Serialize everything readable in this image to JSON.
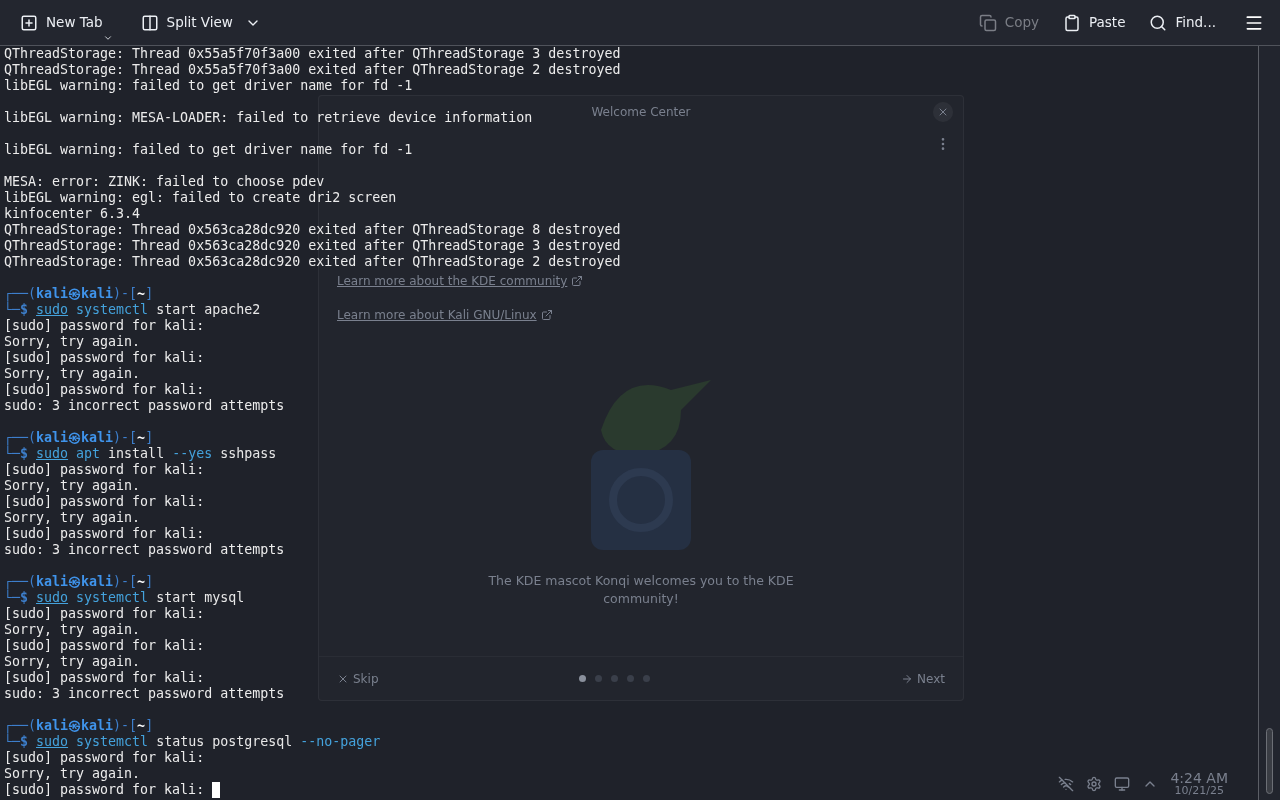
{
  "toolbar": {
    "left": [
      {
        "kind": "new_tab",
        "label": "New Tab"
      },
      {
        "kind": "split_view",
        "label": "Split View"
      }
    ],
    "right": [
      {
        "kind": "copy",
        "label": "Copy",
        "disabled": true
      },
      {
        "kind": "paste",
        "label": "Paste",
        "disabled": false
      },
      {
        "kind": "find",
        "label": "Find..."
      }
    ]
  },
  "background_window": {
    "title": "Welcome Center",
    "links": [
      "Learn more about the KDE community",
      "Learn more about Kali GNU/Linux"
    ],
    "caption": "The KDE mascot Konqi welcomes you to the KDE community!",
    "skip": "Skip",
    "next": "Next",
    "pages": [
      {
        "selected": true
      },
      {
        "selected": false
      },
      {
        "selected": false
      },
      {
        "selected": false
      },
      {
        "selected": false
      }
    ]
  },
  "desktop_clock": {
    "time": "4:24 AM",
    "date": "10/21/25"
  },
  "terminal": {
    "lines": [
      {
        "kind": "output",
        "text": "QThreadStorage: Thread 0x55a5f70f3a00 exited after QThreadStorage 3 destroyed"
      },
      {
        "kind": "output",
        "text": "QThreadStorage: Thread 0x55a5f70f3a00 exited after QThreadStorage 2 destroyed"
      },
      {
        "kind": "output",
        "text": "libEGL warning: failed to get driver name for fd -1"
      },
      {
        "kind": "blank"
      },
      {
        "kind": "output",
        "text": "libEGL warning: MESA-LOADER: failed to retrieve device information"
      },
      {
        "kind": "blank"
      },
      {
        "kind": "output",
        "text": "libEGL warning: failed to get driver name for fd -1"
      },
      {
        "kind": "blank"
      },
      {
        "kind": "output",
        "text": "MESA: error: ZINK: failed to choose pdev"
      },
      {
        "kind": "output",
        "text": "libEGL warning: egl: failed to create dri2 screen"
      },
      {
        "kind": "output",
        "text": "kinfocenter 6.3.4"
      },
      {
        "kind": "output",
        "text": "QThreadStorage: Thread 0x563ca28dc920 exited after QThreadStorage 8 destroyed"
      },
      {
        "kind": "output",
        "text": "QThreadStorage: Thread 0x563ca28dc920 exited after QThreadStorage 3 destroyed"
      },
      {
        "kind": "output",
        "text": "QThreadStorage: Thread 0x563ca28dc920 exited after QThreadStorage 2 destroyed"
      },
      {
        "kind": "blank"
      },
      {
        "kind": "prompt",
        "segments": [
          {
            "kind": "frame",
            "text": "┌──("
          },
          {
            "kind": "user",
            "text": "kali㉿kali"
          },
          {
            "kind": "frame",
            "text": ")-["
          },
          {
            "kind": "dir",
            "text": "~"
          },
          {
            "kind": "frame",
            "text": "]"
          }
        ]
      },
      {
        "kind": "command",
        "segments": [
          {
            "kind": "frame",
            "text": "└─$"
          },
          {
            "kind": "sudo",
            "text": "sudo"
          },
          {
            "kind": "program",
            "text": "systemctl"
          },
          {
            "kind": "arg",
            "text": "start"
          },
          {
            "kind": "arg",
            "text": "apache2"
          }
        ]
      },
      {
        "kind": "output",
        "text": "[sudo] password for kali:"
      },
      {
        "kind": "output",
        "text": "Sorry, try again."
      },
      {
        "kind": "output",
        "text": "[sudo] password for kali:"
      },
      {
        "kind": "output",
        "text": "Sorry, try again."
      },
      {
        "kind": "output",
        "text": "[sudo] password for kali:"
      },
      {
        "kind": "output",
        "text": "sudo: 3 incorrect password attempts"
      },
      {
        "kind": "blank"
      },
      {
        "kind": "prompt",
        "segments": [
          {
            "kind": "frame",
            "text": "┌──("
          },
          {
            "kind": "user",
            "text": "kali㉿kali"
          },
          {
            "kind": "frame",
            "text": ")-["
          },
          {
            "kind": "dir",
            "text": "~"
          },
          {
            "kind": "frame",
            "text": "]"
          }
        ]
      },
      {
        "kind": "command",
        "segments": [
          {
            "kind": "frame",
            "text": "└─$"
          },
          {
            "kind": "sudo",
            "text": "sudo"
          },
          {
            "kind": "program",
            "text": "apt"
          },
          {
            "kind": "arg",
            "text": "install"
          },
          {
            "kind": "option",
            "text": "--yes"
          },
          {
            "kind": "arg",
            "text": "sshpass"
          }
        ]
      },
      {
        "kind": "output",
        "text": "[sudo] password for kali:"
      },
      {
        "kind": "output",
        "text": "Sorry, try again."
      },
      {
        "kind": "output",
        "text": "[sudo] password for kali:"
      },
      {
        "kind": "output",
        "text": "Sorry, try again."
      },
      {
        "kind": "output",
        "text": "[sudo] password for kali:"
      },
      {
        "kind": "output",
        "text": "sudo: 3 incorrect password attempts"
      },
      {
        "kind": "blank"
      },
      {
        "kind": "prompt",
        "segments": [
          {
            "kind": "frame",
            "text": "┌──("
          },
          {
            "kind": "user",
            "text": "kali㉿kali"
          },
          {
            "kind": "frame",
            "text": ")-["
          },
          {
            "kind": "dir",
            "text": "~"
          },
          {
            "kind": "frame",
            "text": "]"
          }
        ]
      },
      {
        "kind": "command",
        "segments": [
          {
            "kind": "frame",
            "text": "└─$"
          },
          {
            "kind": "sudo",
            "text": "sudo"
          },
          {
            "kind": "program",
            "text": "systemctl"
          },
          {
            "kind": "arg",
            "text": "start"
          },
          {
            "kind": "arg",
            "text": "mysql"
          }
        ]
      },
      {
        "kind": "output",
        "text": "[sudo] password for kali:"
      },
      {
        "kind": "output",
        "text": "Sorry, try again."
      },
      {
        "kind": "output",
        "text": "[sudo] password for kali:"
      },
      {
        "kind": "output",
        "text": "Sorry, try again."
      },
      {
        "kind": "output",
        "text": "[sudo] password for kali:"
      },
      {
        "kind": "output",
        "text": "sudo: 3 incorrect password attempts"
      },
      {
        "kind": "blank"
      },
      {
        "kind": "prompt",
        "segments": [
          {
            "kind": "frame",
            "text": "┌──("
          },
          {
            "kind": "user",
            "text": "kali㉿kali"
          },
          {
            "kind": "frame",
            "text": ")-["
          },
          {
            "kind": "dir",
            "text": "~"
          },
          {
            "kind": "frame",
            "text": "]"
          }
        ]
      },
      {
        "kind": "command",
        "segments": [
          {
            "kind": "frame",
            "text": "└─$"
          },
          {
            "kind": "sudo",
            "text": "sudo"
          },
          {
            "kind": "program",
            "text": "systemctl"
          },
          {
            "kind": "arg",
            "text": "status"
          },
          {
            "kind": "arg",
            "text": "postgresql"
          },
          {
            "kind": "option",
            "text": "--no-pager"
          }
        ]
      },
      {
        "kind": "output",
        "text": "[sudo] password for kali:"
      },
      {
        "kind": "output",
        "text": "Sorry, try again."
      },
      {
        "kind": "input",
        "text": "[sudo] password for kali:",
        "cursor": true
      }
    ]
  }
}
